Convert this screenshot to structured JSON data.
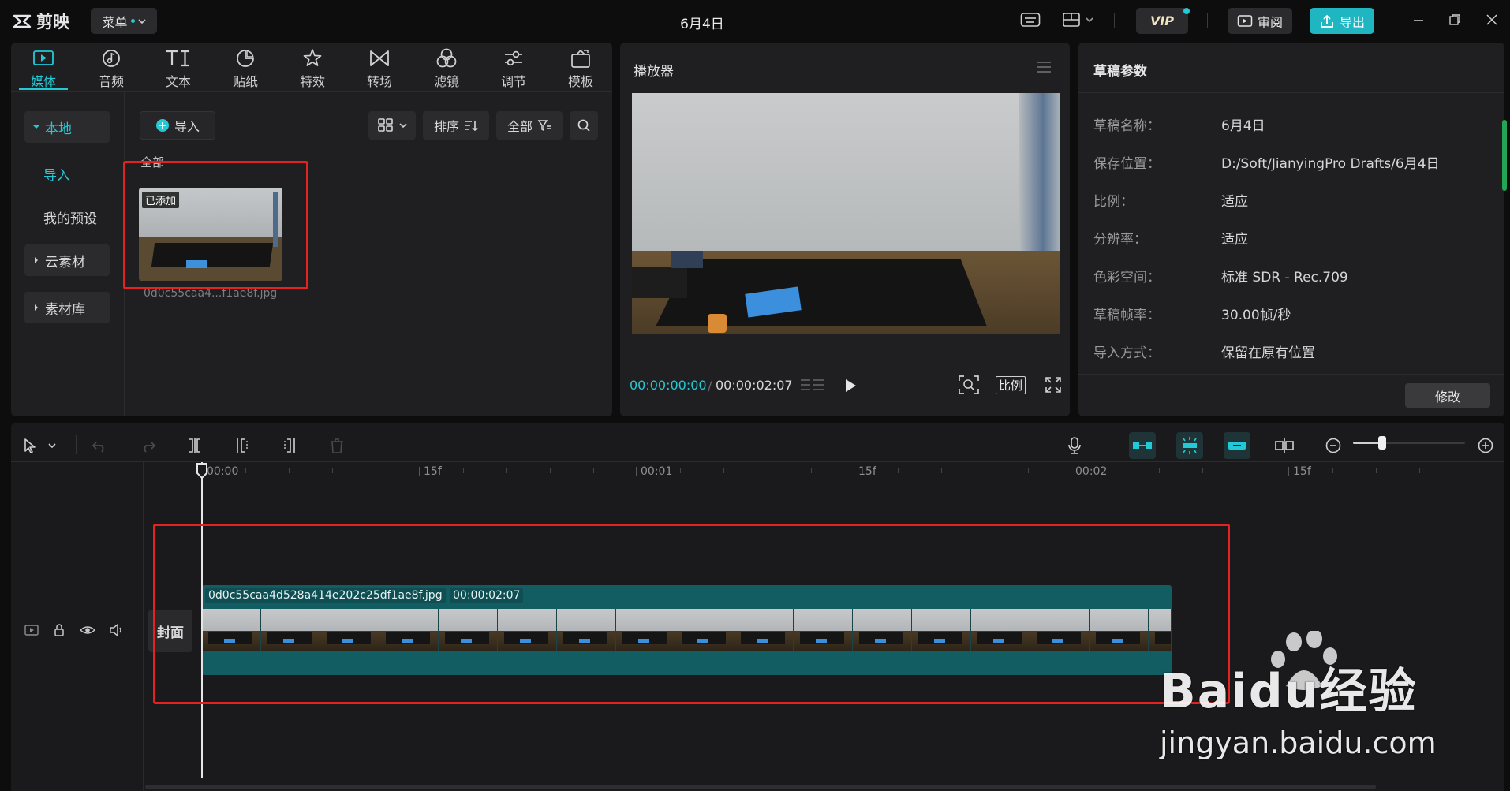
{
  "app": {
    "name": "剪映",
    "menu_label": "菜单",
    "title": "6月4日",
    "vip_label": "VIP",
    "review_label": "审阅",
    "export_label": "导出"
  },
  "media_tabs": [
    {
      "label": "媒体",
      "icon": "media-icon",
      "active": true
    },
    {
      "label": "音频",
      "icon": "audio-icon"
    },
    {
      "label": "文本",
      "icon": "text-icon"
    },
    {
      "label": "贴纸",
      "icon": "sticker-icon"
    },
    {
      "label": "特效",
      "icon": "effects-icon"
    },
    {
      "label": "转场",
      "icon": "transition-icon"
    },
    {
      "label": "滤镜",
      "icon": "filter-icon"
    },
    {
      "label": "调节",
      "icon": "adjust-icon"
    },
    {
      "label": "模板",
      "icon": "template-icon"
    }
  ],
  "sidebar": {
    "local_label": "本地",
    "import_label": "导入",
    "presets_label": "我的预设",
    "cloud_label": "云素材",
    "library_label": "素材库"
  },
  "media_toolbar": {
    "import_label": "导入",
    "sort_label": "排序",
    "filter_label": "全部"
  },
  "media": {
    "section_label": "全部",
    "item_badge": "已添加",
    "item_name": "0d0c55caa4...f1ae8f.jpg"
  },
  "player": {
    "title": "播放器",
    "current_time": "00:00:00:00",
    "total_time": "00:00:02:07",
    "ratio_label": "比例"
  },
  "draft": {
    "title": "草稿参数",
    "params": [
      {
        "label": "草稿名称：",
        "value": "6月4日"
      },
      {
        "label": "保存位置：",
        "value": "D:/Soft/JianyingPro Drafts/6月4日"
      },
      {
        "label": "比例：",
        "value": "适应"
      },
      {
        "label": "分辨率：",
        "value": "适应"
      },
      {
        "label": "色彩空间：",
        "value": "标准 SDR - Rec.709"
      },
      {
        "label": "草稿帧率：",
        "value": "30.00帧/秒"
      },
      {
        "label": "导入方式：",
        "value": "保留在原有位置"
      }
    ],
    "modify_label": "修改"
  },
  "timeline": {
    "ruler": [
      "00:00",
      "15f",
      "00:01",
      "15f",
      "00:02",
      "15f"
    ],
    "cover_label": "封面",
    "clip_name": "0d0c55caa4d528a414e202c25df1ae8f.jpg",
    "clip_duration": "00:00:02:07",
    "zoom_level": 0.26
  },
  "watermark": {
    "brand": "Baidu经验",
    "url": "jingyan.baidu.com"
  },
  "colors": {
    "accent": "#22c9d6",
    "clip": "#125d62",
    "highlight": "#e3231f"
  }
}
